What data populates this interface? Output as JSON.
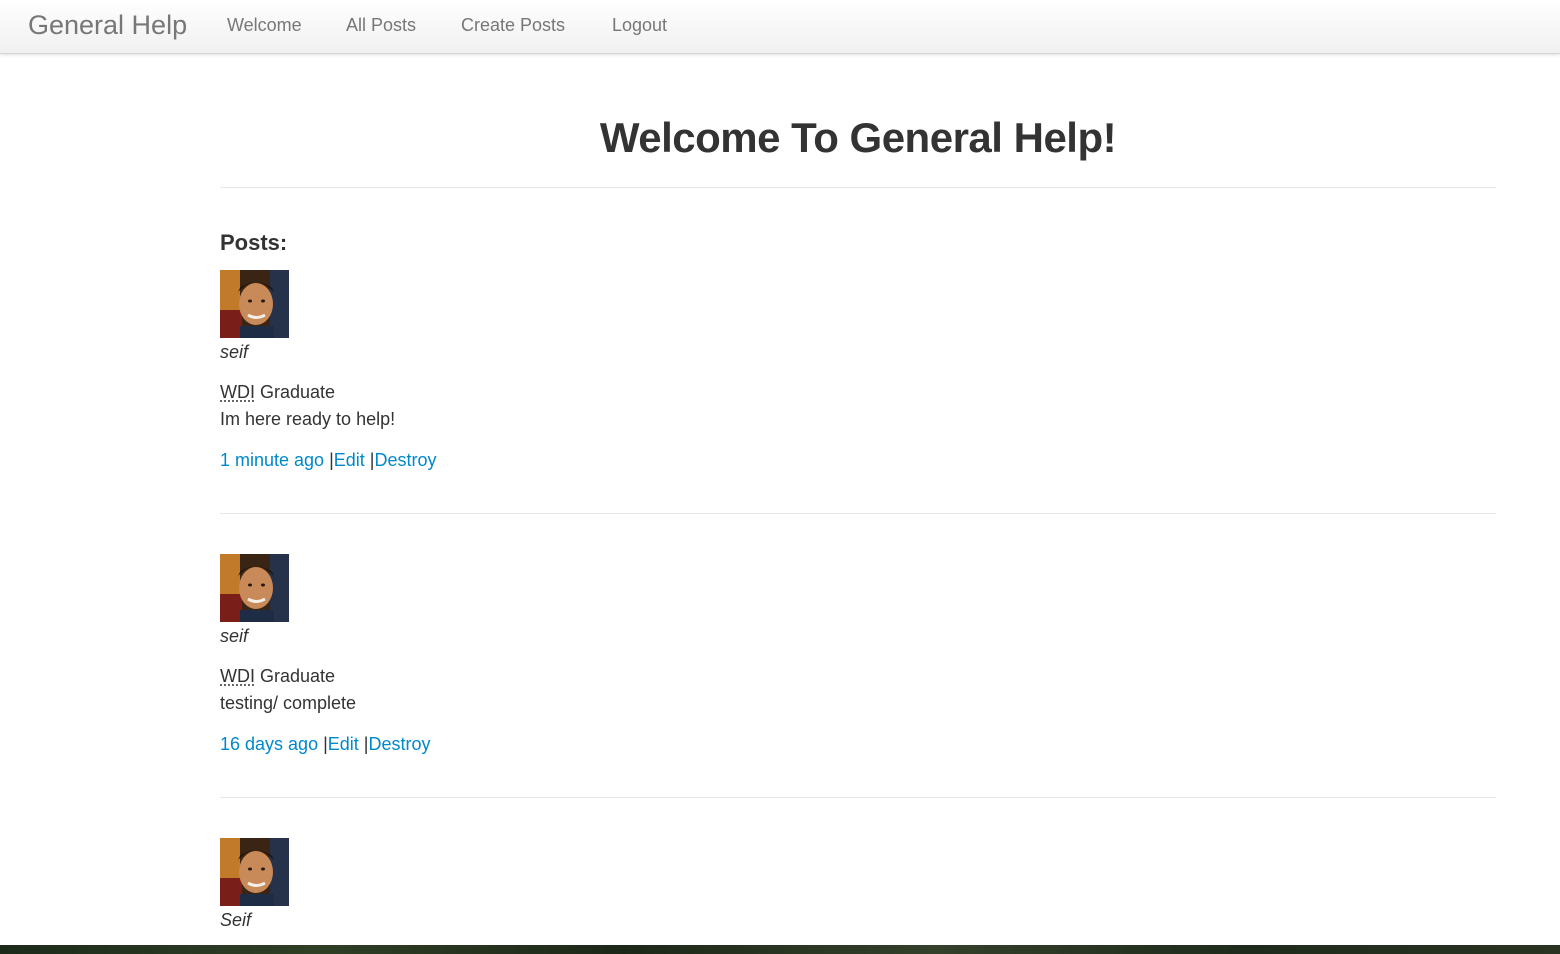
{
  "navbar": {
    "brand": "General Help",
    "items": [
      {
        "label": "Welcome"
      },
      {
        "label": "All Posts"
      },
      {
        "label": "Create Posts"
      },
      {
        "label": "Logout"
      }
    ]
  },
  "main": {
    "title": "Welcome To General Help!",
    "posts_heading": "Posts:",
    "posts": [
      {
        "author": "seif",
        "role_abbr": "WDI",
        "role_rest": " Graduate",
        "content": "Im here ready to help!",
        "time": "1 minute ago",
        "edit": "Edit",
        "destroy": "Destroy"
      },
      {
        "author": "seif",
        "role_abbr": "WDI",
        "role_rest": " Graduate",
        "content": "testing/ complete",
        "time": "16 days ago",
        "edit": "Edit",
        "destroy": "Destroy"
      },
      {
        "author": "Seif"
      }
    ],
    "separator": " |"
  },
  "colors": {
    "link": "#0088cc",
    "text": "#333333",
    "nav_text": "#777777"
  },
  "icons": {
    "avatar": "user-photo"
  }
}
